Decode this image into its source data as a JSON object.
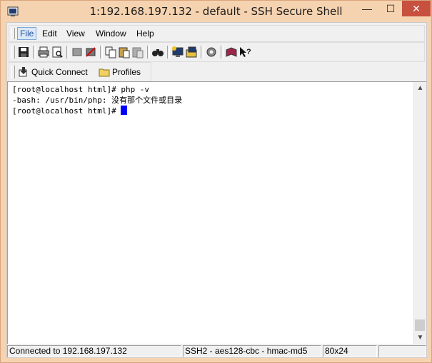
{
  "window": {
    "title": "1:192.168.197.132 - default - SSH Secure Shell",
    "minimize_glyph": "—",
    "maximize_glyph": "☐",
    "close_glyph": "✕"
  },
  "menu": [
    "File",
    "Edit",
    "View",
    "Window",
    "Help"
  ],
  "toolbar": {
    "icons": [
      "save-icon",
      "print-icon",
      "print-preview-icon",
      "disconnect-icon",
      "disconnect-all-icon",
      "copy-icon",
      "paste-icon",
      "paste-disabled-icon",
      "find-icon",
      "new-terminal-icon",
      "new-file-transfer-icon",
      "settings-icon",
      "help-book-icon",
      "context-help-icon"
    ]
  },
  "quickbar": {
    "quick_connect": "Quick Connect",
    "profiles": "Profiles"
  },
  "terminal": {
    "lines": [
      "[root@localhost html]# php -v",
      "-bash: /usr/bin/php: 没有那个文件或目录",
      "[root@localhost html]# "
    ]
  },
  "status": {
    "connection": "Connected to 192.168.197.132",
    "cipher": "SSH2 - aes128-cbc - hmac-md5",
    "size": "80x24"
  }
}
